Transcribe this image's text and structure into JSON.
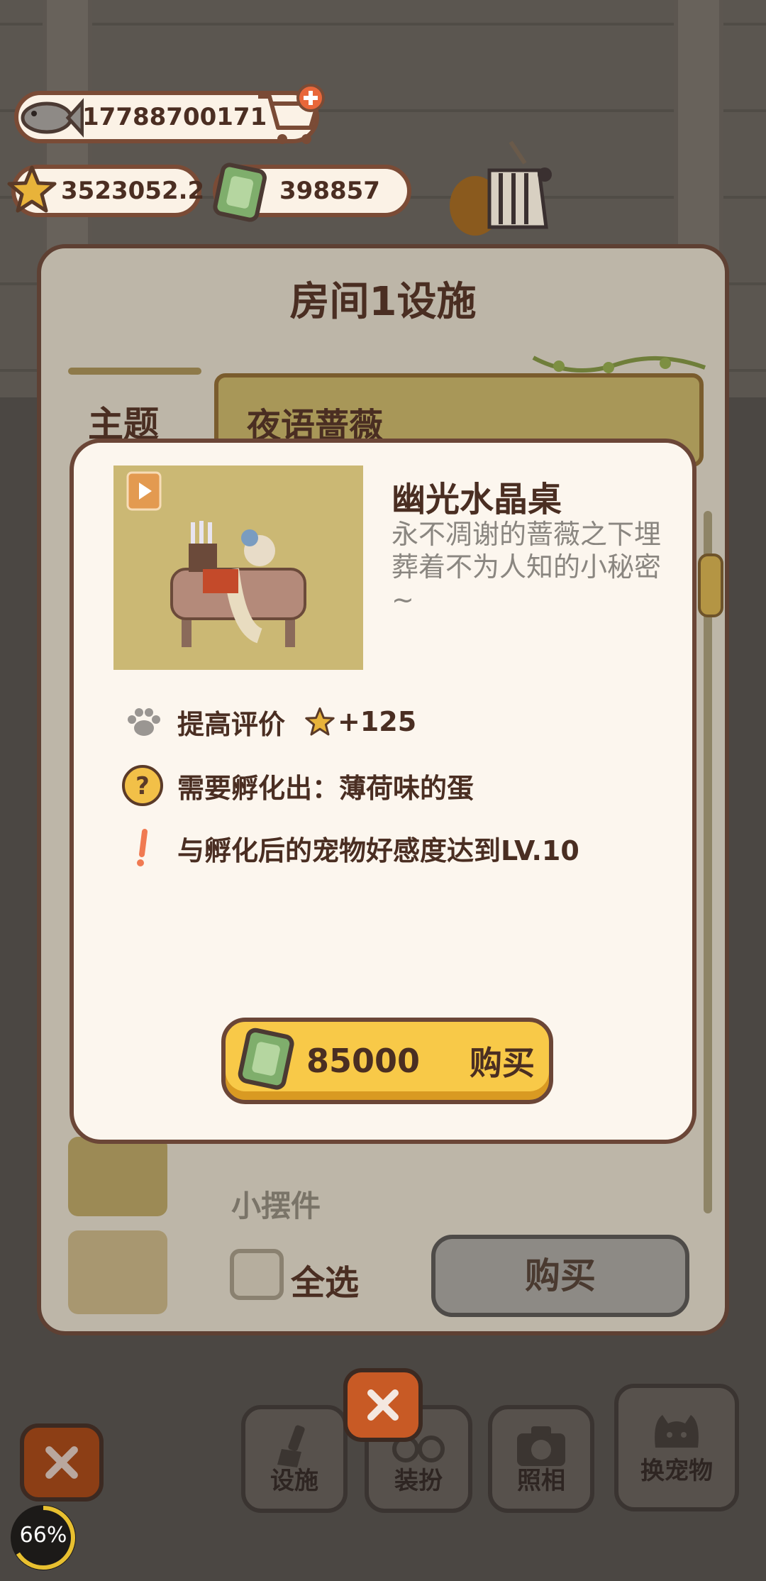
{
  "currencies": {
    "fish": "17788700171",
    "stars": "3523052.2",
    "tickets": "398857"
  },
  "panel": {
    "title": "房间1设施",
    "tab_label": "主题",
    "theme_name": "夜语蔷薇",
    "sub_section": "小摆件",
    "select_all_label": "全选",
    "buy_label": "购买"
  },
  "item": {
    "name": "幽光水晶桌",
    "description": "永不凋谢的蔷薇之下埋葬着不为人知的小秘密~",
    "rating_label": "提高评价",
    "rating_value": "+125",
    "requirement": "需要孵化出：薄荷味的蛋",
    "condition": "与孵化后的宠物好感度达到LV.10",
    "price": "85000",
    "buy_label": "购买"
  },
  "bottom_nav": {
    "facility": "设施",
    "dress": "装扮",
    "photo": "照相",
    "change_pet": "换宠物"
  },
  "progress": {
    "value_text": "66%",
    "value": 0.66
  },
  "colors": {
    "accent_yellow": "#f8c948",
    "border_brown": "#6b4637",
    "modal_bg": "#fcf6ee"
  }
}
